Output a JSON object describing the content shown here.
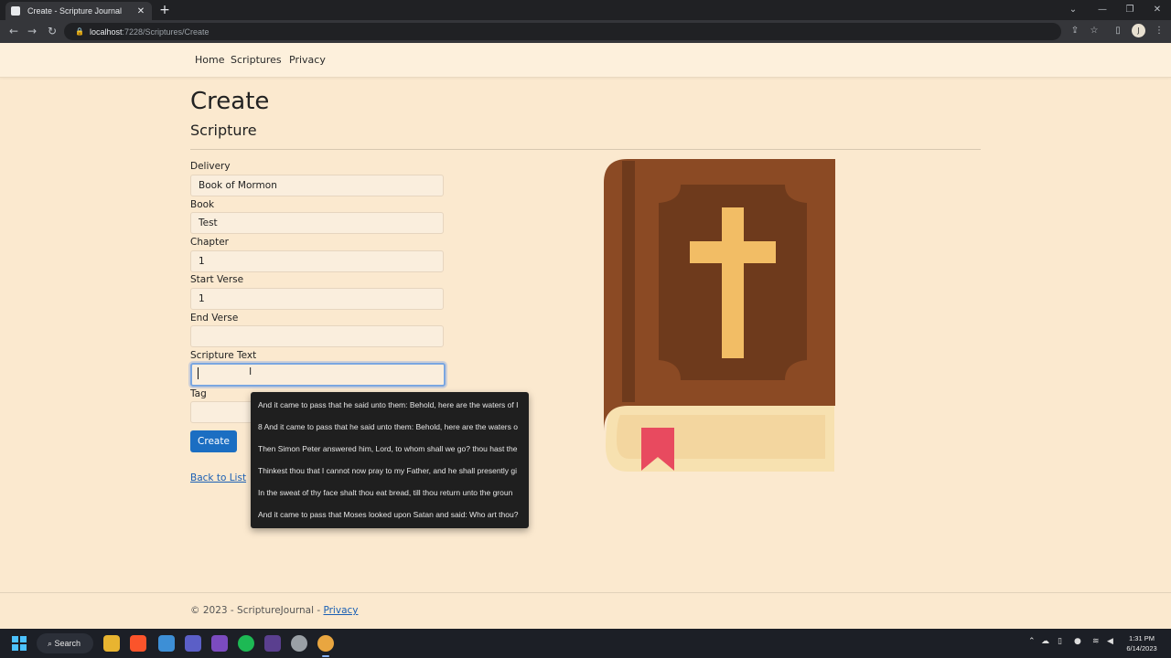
{
  "browser": {
    "tab_title": "Create - Scripture Journal",
    "tab_close": "✕",
    "new_tab": "+",
    "url_host": "localhost",
    "url_path": ":7228/Scriptures/Create",
    "window_controls": [
      "⌄",
      "—",
      "❐",
      "✕"
    ]
  },
  "nav": {
    "items": [
      "Home",
      "Scriptures",
      "Privacy"
    ]
  },
  "page": {
    "title": "Create",
    "subtitle": "Scripture"
  },
  "form": {
    "fields": [
      {
        "label": "Delivery",
        "value": "Book of Mormon"
      },
      {
        "label": "Book",
        "value": "Test"
      },
      {
        "label": "Chapter",
        "value": "1"
      },
      {
        "label": "Start Verse",
        "value": "1"
      },
      {
        "label": "End Verse",
        "value": ""
      },
      {
        "label": "Scripture Text",
        "value": ""
      },
      {
        "label": "Tag",
        "value": ""
      }
    ],
    "submit_label": "Create",
    "back_link": "Back to List"
  },
  "autocomplete": {
    "suggestions": [
      "And it came to pass that he said unto them: Behold, here are the waters of I",
      "8 And it came to pass that he said unto them: Behold, here are the waters o",
      "Then Simon Peter answered him, Lord, to whom shall we go? thou hast the",
      "Thinkest thou that I cannot now pray to my Father, and he shall presently gi",
      "In the sweat of thy face shalt thou eat bread, till thou return unto the groun",
      "And it came to pass that Moses looked upon Satan and said: Who art thou?"
    ]
  },
  "footer": {
    "text": "© 2023 - ScriptureJournal - ",
    "privacy_link": "Privacy"
  },
  "taskbar": {
    "search_label": "Search",
    "time": "1:31 PM",
    "date": "6/14/2023"
  },
  "colors": {
    "page_bg": "#fbe9cf",
    "primary_button": "#1b6ec2",
    "book_cover": "#8b4a24",
    "book_panel": "#6e3a1c",
    "cross": "#f2bd65",
    "pages": "#f7e1b0",
    "bookmark": "#e84a5f"
  }
}
